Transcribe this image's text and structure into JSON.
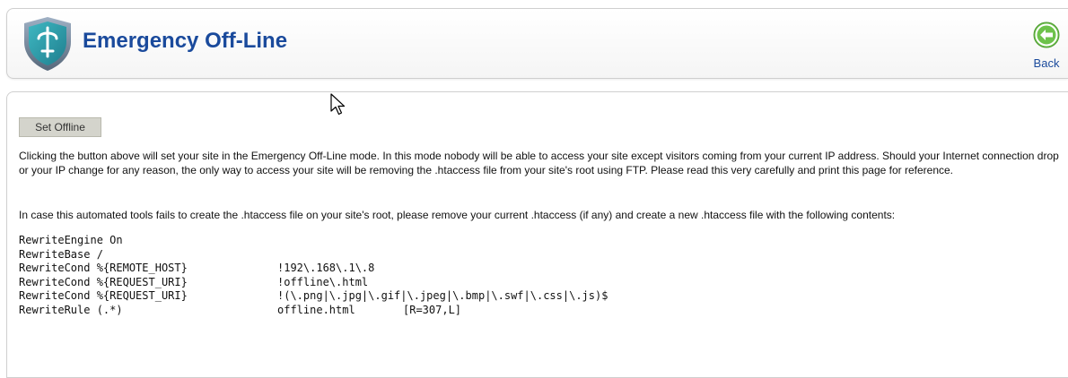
{
  "header": {
    "title": "Emergency Off-Line",
    "logo_icon": "shield-logo-icon",
    "back_label": "Back",
    "back_icon": "back-arrow-icon"
  },
  "main": {
    "set_offline_button": "Set Offline",
    "paragraph1": "Clicking the button above will set your site in the Emergency Off-Line mode. In this mode nobody will be able to access your site except visitors coming from your current IP address. Should your Internet connection drop or your IP change for any reason, the only way to access your site will be removing the .htaccess file from your site's root using FTP. Please read this very carefully and print this page for reference.",
    "paragraph2": "In case this automated tools fails to create the .htaccess file on your site's root, please remove your current .htaccess (if any) and create a new .htaccess file with the following contents:",
    "code": {
      "line1": "RewriteEngine On",
      "line2": "RewriteBase /",
      "line3": {
        "directive": "RewriteCond %{REMOTE_HOST}",
        "value": "!192\\.168\\.1\\.8"
      },
      "line4": {
        "directive": "RewriteCond %{REQUEST_URI}",
        "value": "!offline\\.html"
      },
      "line5": {
        "directive": "RewriteCond %{REQUEST_URI}",
        "value": "!(\\.png|\\.jpg|\\.gif|\\.jpeg|\\.bmp|\\.swf|\\.css|\\.js)$"
      },
      "line6": {
        "directive": "RewriteRule (.*)",
        "target": "offline.html",
        "flags": "[R=307,L]"
      }
    }
  },
  "colors": {
    "title": "#1a4a9c",
    "back_button_green": "#6dc24b",
    "button_bg": "#d4d4cc"
  }
}
